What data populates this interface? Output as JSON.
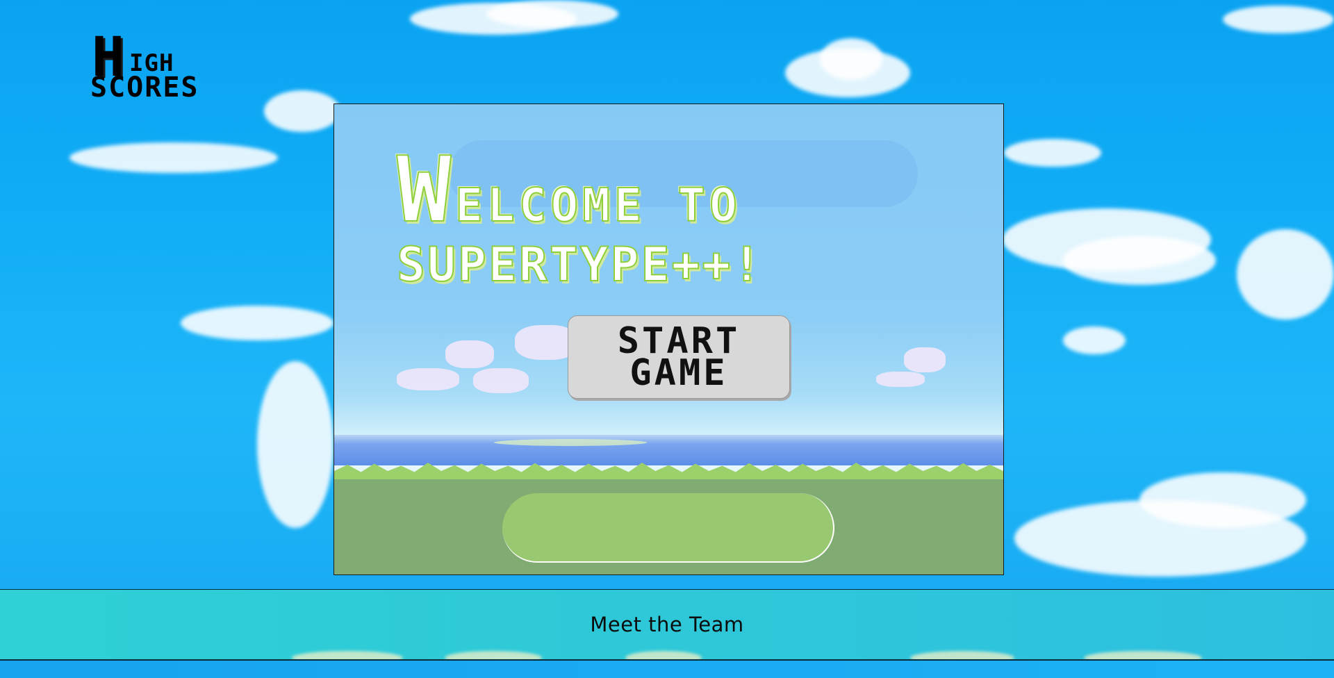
{
  "high_scores": {
    "first_letter": "H",
    "rest_first_word": "IGH",
    "second_word": "SCORES"
  },
  "game": {
    "title_line1_cap": "W",
    "title_line1_rest": "ELCOME TO",
    "title_line2": "SUPERTYPE++!",
    "start_button_label": "START\nGAME",
    "input_placeholder": ""
  },
  "footer": {
    "meet_team_label": "Meet the Team"
  },
  "colors": {
    "sky": "#12aef6",
    "title_outline": "#8fcf3a",
    "ground": "#80ab72",
    "input_fill": "#98c86f",
    "footer_bg": "#2ec8d8"
  },
  "icons": {
    "high_scores_logo": "pixel-text-logo"
  }
}
